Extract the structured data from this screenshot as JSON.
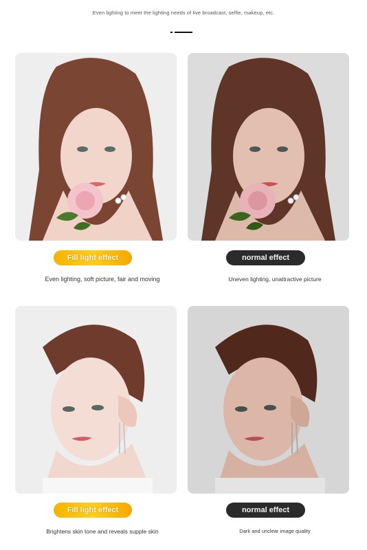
{
  "header": {
    "subtitle": "Even lighting to meet the lighting needs of live broadcast, selfie, makeup, etc."
  },
  "comparisons": [
    {
      "left": {
        "badge": "Fill light effect",
        "caption": "Even lighting, soft picture, fair and moving"
      },
      "right": {
        "badge": "normal effect",
        "caption": "Uneven lighting, unattractive picture"
      }
    },
    {
      "left": {
        "badge": "Fill light effect",
        "caption": "Brightens skin tone and reveals supple skin"
      },
      "right": {
        "badge": "normal effect",
        "caption": "Dark and unclear image quality"
      }
    }
  ],
  "colors": {
    "fill_badge": "#f4b400",
    "normal_badge": "#2b2b2b"
  }
}
